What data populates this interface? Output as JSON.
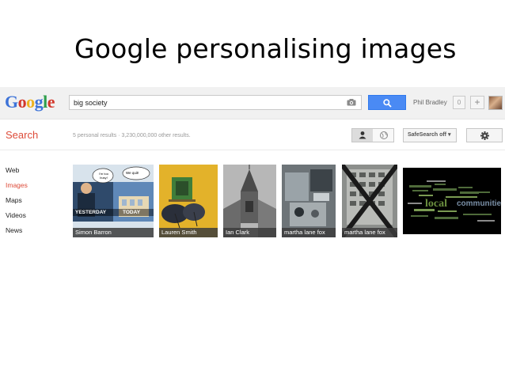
{
  "slide": {
    "title": "Google personalising images"
  },
  "header": {
    "logo_letters": [
      "G",
      "o",
      "o",
      "g",
      "l",
      "e"
    ],
    "logo_colors": [
      "#3d73d8",
      "#d3372b",
      "#eeb321",
      "#3d73d8",
      "#2e9e4c",
      "#d3372b"
    ],
    "query": "big society",
    "camera_icon": "camera-icon",
    "search_icon": "magnifier-icon",
    "user_name": "Phil Bradley",
    "notification_count": "0",
    "share_label": "+"
  },
  "subbar": {
    "search_label": "Search",
    "results_text": "5 personal results · 3,230,000,000 other results.",
    "personal_icon": "person-icon",
    "global_icon": "globe-icon",
    "safesearch_label": "SafeSearch off ▾",
    "settings_icon": "gear-icon"
  },
  "nav": {
    "items": [
      {
        "label": "Web",
        "active": false
      },
      {
        "label": "Images",
        "active": true
      },
      {
        "label": "Maps",
        "active": false
      },
      {
        "label": "Videos",
        "active": false
      },
      {
        "label": "News",
        "active": false
      }
    ]
  },
  "results": {
    "images": [
      {
        "caption": "Simon Barron",
        "overlay_left": "YESTERDAY",
        "overlay_right": "TODAY",
        "bubble_left": "I'm too busy!",
        "bubble_right": "We quit!"
      },
      {
        "caption": "Lauren Smith"
      },
      {
        "caption": "Ian Clark"
      },
      {
        "caption": "martha lane fox"
      },
      {
        "caption": "martha lane fox"
      },
      {
        "caption": "",
        "cloud_words": [
          "local",
          "communities"
        ]
      }
    ]
  },
  "colors": {
    "accent_red": "#dd4b39",
    "search_blue": "#4a8af4",
    "topbar_gray": "#f1f1f1"
  }
}
